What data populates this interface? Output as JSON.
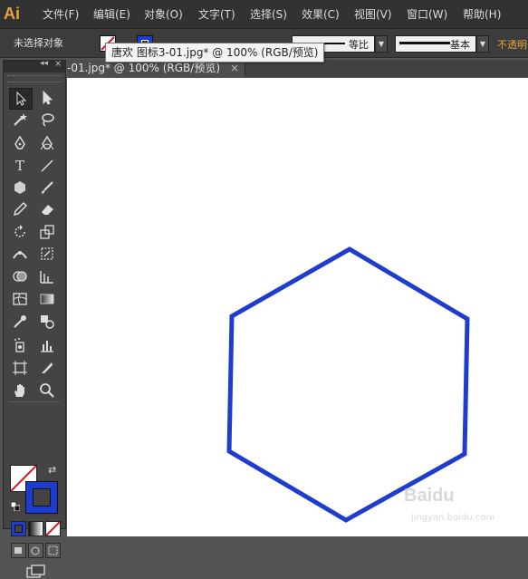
{
  "app": {
    "logo": "Ai"
  },
  "menu": [
    "文件(F)",
    "编辑(E)",
    "对象(O)",
    "文字(T)",
    "选择(S)",
    "效果(C)",
    "视图(V)",
    "窗口(W)",
    "帮助(H)"
  ],
  "control_bar": {
    "selection_label": "未选择对象",
    "stroke_style_label": "等比",
    "profile_label": "基本",
    "opacity_label": "不透明"
  },
  "tooltip": {
    "text": "唐欢 图标3-01.jpg* @ 100% (RGB/预览)"
  },
  "document": {
    "tab_title": "-01.jpg* @ 100% (RGB/预览)",
    "tab_close": "×"
  },
  "toolbox": {
    "collapse": "◂◂",
    "close": "×"
  },
  "colors": {
    "stroke": "#1e3ccf",
    "fill": "none",
    "accent": "#e8a33d"
  },
  "watermark": {
    "brand": "Baidu",
    "sub": "jingyan.baidu.com"
  }
}
